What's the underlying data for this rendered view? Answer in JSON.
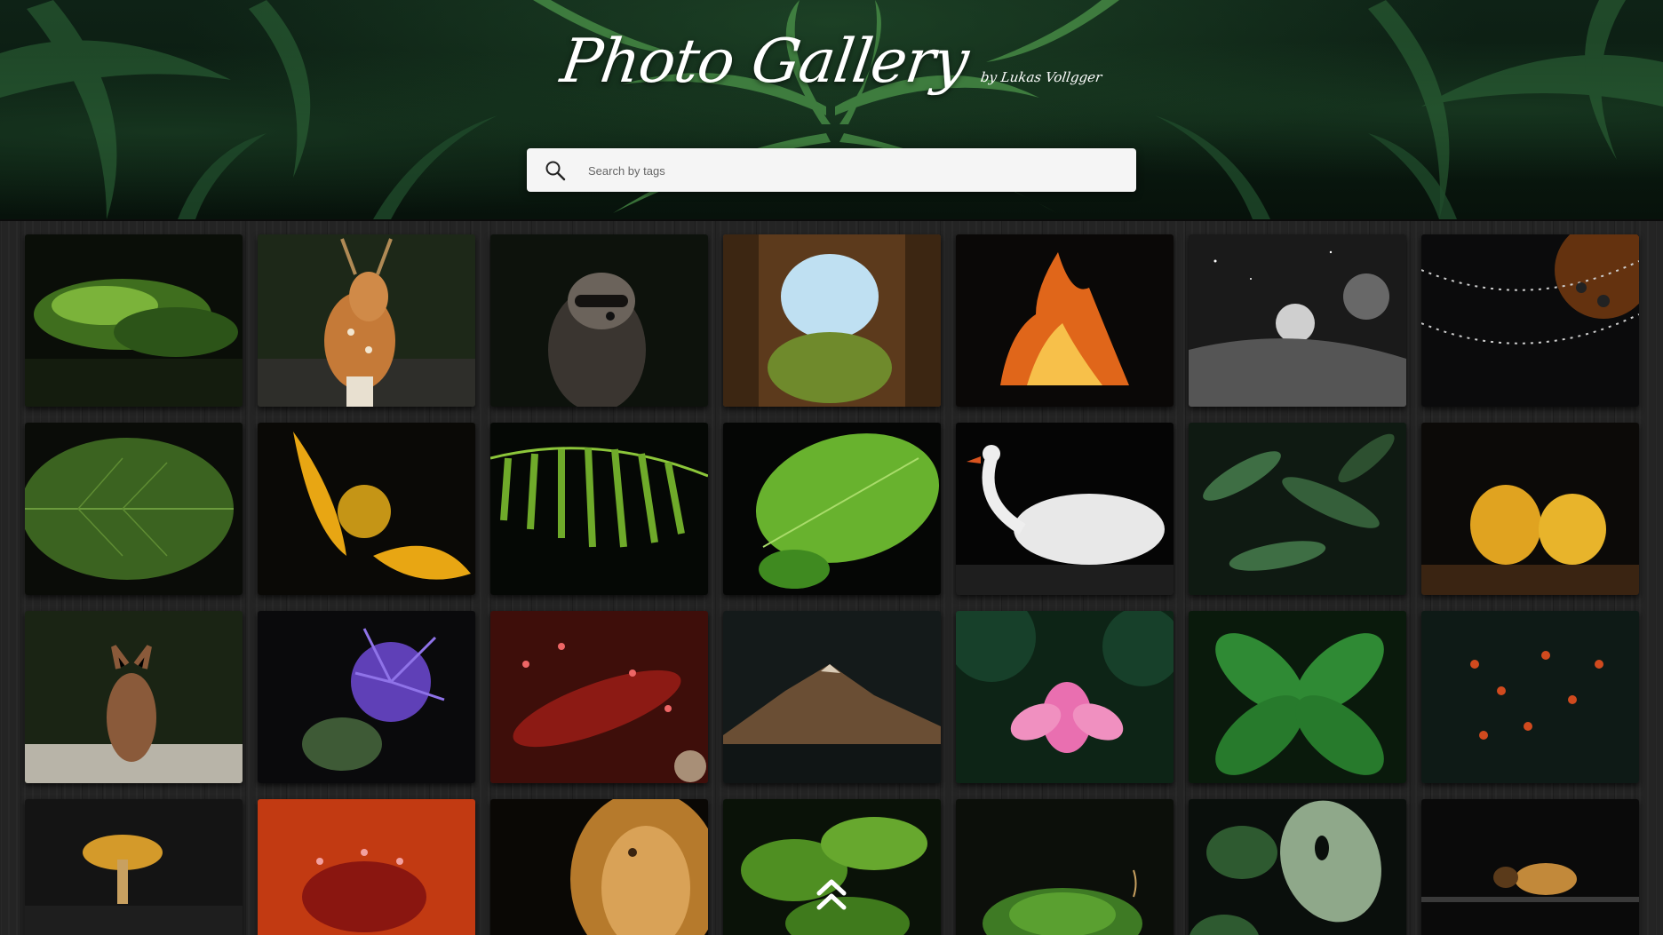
{
  "header": {
    "title": "Photo Gallery",
    "subtitle": "by Lukas Vollgger"
  },
  "search": {
    "placeholder": "Search by tags",
    "value": "",
    "icon": "search-icon"
  },
  "gallery": {
    "photos": [
      {
        "subject": "moss"
      },
      {
        "subject": "deer"
      },
      {
        "subject": "raccoon"
      },
      {
        "subject": "cave"
      },
      {
        "subject": "fire"
      },
      {
        "subject": "moon"
      },
      {
        "subject": "dewdrops"
      },
      {
        "subject": "leaf-drops"
      },
      {
        "subject": "yellow-flower"
      },
      {
        "subject": "fern"
      },
      {
        "subject": "green-leaf"
      },
      {
        "subject": "swan"
      },
      {
        "subject": "dark-leaves"
      },
      {
        "subject": "lantern-husks"
      },
      {
        "subject": "fox"
      },
      {
        "subject": "thistle"
      },
      {
        "subject": "sundew"
      },
      {
        "subject": "mountain"
      },
      {
        "subject": "lotus"
      },
      {
        "subject": "nettle"
      },
      {
        "subject": "berries"
      },
      {
        "subject": "mushroom"
      },
      {
        "subject": "red-sundew"
      },
      {
        "subject": "lion"
      },
      {
        "subject": "foliage"
      },
      {
        "subject": "moss-sprout"
      },
      {
        "subject": "monstera"
      },
      {
        "subject": "bee"
      }
    ]
  },
  "scroll_top": {
    "icon": "double-chevron-up-icon"
  }
}
